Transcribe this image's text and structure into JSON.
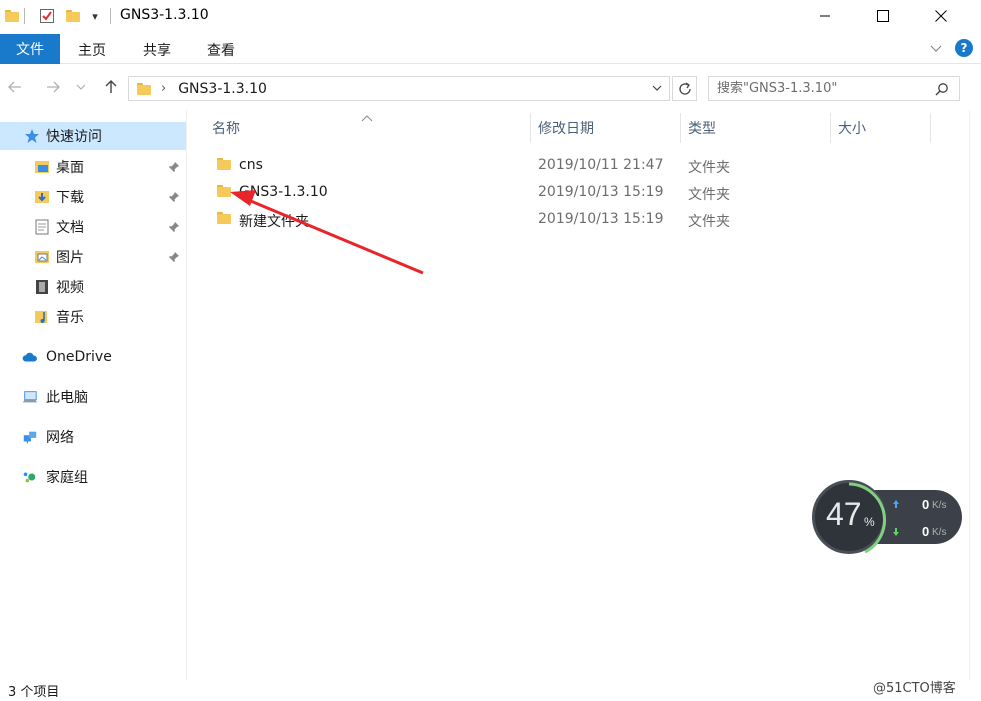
{
  "window": {
    "title": "GNS3-1.3.10",
    "quick_access_dropdown": "▾",
    "minimize": "—",
    "maximize": "☐",
    "close": "✕"
  },
  "ribbon": {
    "tabs": [
      "文件",
      "主页",
      "共享",
      "查看"
    ],
    "help": "?"
  },
  "address": {
    "path": "GNS3-1.3.10",
    "search_placeholder": "搜索\"GNS3-1.3.10\""
  },
  "nav": {
    "quick_access": "快速访问",
    "items": [
      "桌面",
      "下载",
      "文档",
      "图片",
      "视频",
      "音乐"
    ],
    "onedrive": "OneDrive",
    "this_pc": "此电脑",
    "network": "网络",
    "homegroup": "家庭组"
  },
  "columns": {
    "name": "名称",
    "date": "修改日期",
    "type": "类型",
    "size": "大小"
  },
  "files": [
    {
      "name": "cns",
      "date": "2019/10/11 21:47",
      "type": "文件夹"
    },
    {
      "name": "GNS3-1.3.10",
      "date": "2019/10/13 15:19",
      "type": "文件夹"
    },
    {
      "name": "新建文件夹",
      "date": "2019/10/13 15:19",
      "type": "文件夹"
    }
  ],
  "status": {
    "count": "3 个项目"
  },
  "widget": {
    "percent": "47",
    "percent_symbol": "%",
    "upload": "0",
    "download": "0",
    "unit": "K/s"
  },
  "watermark": "@51CTO博客",
  "colors": {
    "accent": "#1979ca",
    "selected": "#cce8ff",
    "folder": "#f5c95a",
    "arrow": "#e8262a"
  }
}
